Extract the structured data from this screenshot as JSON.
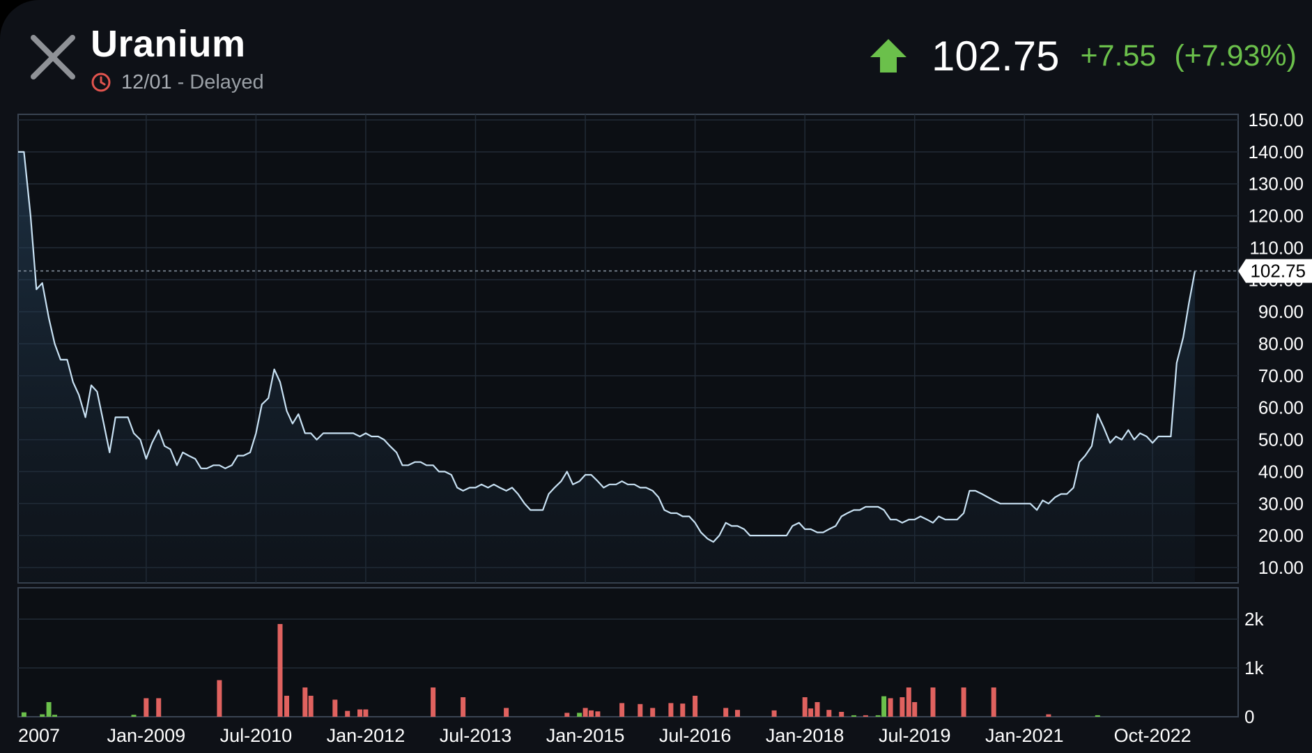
{
  "header": {
    "title": "Uranium",
    "date": "12/01",
    "separator": "-",
    "status": "Delayed",
    "price": "102.75",
    "change": "+7.55",
    "change_pct": "(+7.93%)"
  },
  "colors": {
    "up": "#6bc04b",
    "down": "#e0625f",
    "line": "#c9e2f4",
    "clock": "#e2544e"
  },
  "icons": {
    "close": "close-icon",
    "clock": "clock-icon",
    "trend": "arrow-up-icon"
  },
  "chart_data": {
    "type": "line",
    "price_axis": {
      "ylim": [
        0,
        150
      ],
      "ticks": [
        "150.00",
        "140.00",
        "130.00",
        "120.00",
        "110.00",
        "100.00",
        "90.00",
        "80.00",
        "70.00",
        "60.00",
        "50.00",
        "40.00",
        "30.00",
        "20.00",
        "10.00"
      ],
      "last_value_label": "102.75",
      "last_value": 102.75
    },
    "volume_axis": {
      "ylim": [
        0,
        2700
      ],
      "ticks": [
        {
          "label": "2k",
          "value": 2000
        },
        {
          "label": "1k",
          "value": 1000
        },
        {
          "label": "0",
          "value": 0
        }
      ]
    },
    "x_axis": {
      "range": [
        2007.25,
        2023.92
      ],
      "ticks": [
        {
          "label": "2007",
          "x": 2007.35
        },
        {
          "label": "Jan-2009",
          "x": 2009.0
        },
        {
          "label": "Jul-2010",
          "x": 2010.5
        },
        {
          "label": "Jan-2012",
          "x": 2012.0
        },
        {
          "label": "Jul-2013",
          "x": 2013.5
        },
        {
          "label": "Jan-2015",
          "x": 2015.0
        },
        {
          "label": "Jul-2016",
          "x": 2016.5
        },
        {
          "label": "Jan-2018",
          "x": 2018.0
        },
        {
          "label": "Jul-2019",
          "x": 2019.5
        },
        {
          "label": "Jan-2021",
          "x": 2021.0
        },
        {
          "label": "Oct-2022",
          "x": 2022.75
        }
      ]
    },
    "price_series": [
      [
        2007.25,
        140
      ],
      [
        2007.33,
        140
      ],
      [
        2007.42,
        120
      ],
      [
        2007.5,
        97
      ],
      [
        2007.58,
        99
      ],
      [
        2007.67,
        88
      ],
      [
        2007.75,
        80
      ],
      [
        2007.83,
        75
      ],
      [
        2007.92,
        75
      ],
      [
        2008.0,
        68
      ],
      [
        2008.08,
        64
      ],
      [
        2008.17,
        57
      ],
      [
        2008.25,
        67
      ],
      [
        2008.33,
        65
      ],
      [
        2008.42,
        55
      ],
      [
        2008.5,
        46
      ],
      [
        2008.58,
        57
      ],
      [
        2008.67,
        57
      ],
      [
        2008.75,
        57
      ],
      [
        2008.83,
        52
      ],
      [
        2008.92,
        50
      ],
      [
        2009.0,
        44
      ],
      [
        2009.08,
        49
      ],
      [
        2009.17,
        53
      ],
      [
        2009.25,
        48
      ],
      [
        2009.33,
        47
      ],
      [
        2009.42,
        42
      ],
      [
        2009.5,
        46
      ],
      [
        2009.58,
        45
      ],
      [
        2009.67,
        44
      ],
      [
        2009.75,
        41
      ],
      [
        2009.83,
        41
      ],
      [
        2009.92,
        42
      ],
      [
        2010.0,
        42
      ],
      [
        2010.08,
        41
      ],
      [
        2010.17,
        42
      ],
      [
        2010.25,
        45
      ],
      [
        2010.33,
        45
      ],
      [
        2010.42,
        46
      ],
      [
        2010.5,
        52
      ],
      [
        2010.58,
        61
      ],
      [
        2010.67,
        63
      ],
      [
        2010.75,
        72
      ],
      [
        2010.83,
        68
      ],
      [
        2010.92,
        59
      ],
      [
        2011.0,
        55
      ],
      [
        2011.08,
        58
      ],
      [
        2011.17,
        52
      ],
      [
        2011.25,
        52
      ],
      [
        2011.33,
        50
      ],
      [
        2011.42,
        52
      ],
      [
        2011.5,
        52
      ],
      [
        2011.58,
        52
      ],
      [
        2011.67,
        52
      ],
      [
        2011.75,
        52
      ],
      [
        2011.83,
        52
      ],
      [
        2011.92,
        51
      ],
      [
        2012.0,
        52
      ],
      [
        2012.08,
        51
      ],
      [
        2012.17,
        51
      ],
      [
        2012.25,
        50
      ],
      [
        2012.33,
        48
      ],
      [
        2012.42,
        46
      ],
      [
        2012.5,
        42
      ],
      [
        2012.58,
        42
      ],
      [
        2012.67,
        43
      ],
      [
        2012.75,
        43
      ],
      [
        2012.83,
        42
      ],
      [
        2012.92,
        42
      ],
      [
        2013.0,
        40
      ],
      [
        2013.08,
        40
      ],
      [
        2013.17,
        39
      ],
      [
        2013.25,
        35
      ],
      [
        2013.33,
        34
      ],
      [
        2013.42,
        35
      ],
      [
        2013.5,
        35
      ],
      [
        2013.58,
        36
      ],
      [
        2013.67,
        35
      ],
      [
        2013.75,
        36
      ],
      [
        2013.83,
        35
      ],
      [
        2013.92,
        34
      ],
      [
        2014.0,
        35
      ],
      [
        2014.08,
        33
      ],
      [
        2014.17,
        30
      ],
      [
        2014.25,
        28
      ],
      [
        2014.33,
        28
      ],
      [
        2014.42,
        28
      ],
      [
        2014.5,
        33
      ],
      [
        2014.58,
        35
      ],
      [
        2014.67,
        37
      ],
      [
        2014.75,
        40
      ],
      [
        2014.83,
        36
      ],
      [
        2014.92,
        37
      ],
      [
        2015.0,
        39
      ],
      [
        2015.08,
        39
      ],
      [
        2015.17,
        37
      ],
      [
        2015.25,
        35
      ],
      [
        2015.33,
        36
      ],
      [
        2015.42,
        36
      ],
      [
        2015.5,
        37
      ],
      [
        2015.58,
        36
      ],
      [
        2015.67,
        36
      ],
      [
        2015.75,
        35
      ],
      [
        2015.83,
        35
      ],
      [
        2015.92,
        34
      ],
      [
        2016.0,
        32
      ],
      [
        2016.08,
        28
      ],
      [
        2016.17,
        27
      ],
      [
        2016.25,
        27
      ],
      [
        2016.33,
        26
      ],
      [
        2016.42,
        26
      ],
      [
        2016.5,
        24
      ],
      [
        2016.58,
        21
      ],
      [
        2016.67,
        19
      ],
      [
        2016.75,
        18
      ],
      [
        2016.83,
        20
      ],
      [
        2016.92,
        24
      ],
      [
        2017.0,
        23
      ],
      [
        2017.08,
        23
      ],
      [
        2017.17,
        22
      ],
      [
        2017.25,
        20
      ],
      [
        2017.33,
        20
      ],
      [
        2017.42,
        20
      ],
      [
        2017.5,
        20
      ],
      [
        2017.58,
        20
      ],
      [
        2017.67,
        20
      ],
      [
        2017.75,
        20
      ],
      [
        2017.83,
        23
      ],
      [
        2017.92,
        24
      ],
      [
        2018.0,
        22
      ],
      [
        2018.08,
        22
      ],
      [
        2018.17,
        21
      ],
      [
        2018.25,
        21
      ],
      [
        2018.33,
        22
      ],
      [
        2018.42,
        23
      ],
      [
        2018.5,
        26
      ],
      [
        2018.58,
        27
      ],
      [
        2018.67,
        28
      ],
      [
        2018.75,
        28
      ],
      [
        2018.83,
        29
      ],
      [
        2018.92,
        29
      ],
      [
        2019.0,
        29
      ],
      [
        2019.08,
        28
      ],
      [
        2019.17,
        25
      ],
      [
        2019.25,
        25
      ],
      [
        2019.33,
        24
      ],
      [
        2019.42,
        25
      ],
      [
        2019.5,
        25
      ],
      [
        2019.58,
        26
      ],
      [
        2019.67,
        25
      ],
      [
        2019.75,
        24
      ],
      [
        2019.83,
        26
      ],
      [
        2019.92,
        25
      ],
      [
        2020.0,
        25
      ],
      [
        2020.08,
        25
      ],
      [
        2020.17,
        27
      ],
      [
        2020.25,
        34
      ],
      [
        2020.33,
        34
      ],
      [
        2020.42,
        33
      ],
      [
        2020.5,
        32
      ],
      [
        2020.58,
        31
      ],
      [
        2020.67,
        30
      ],
      [
        2020.75,
        30
      ],
      [
        2020.83,
        30
      ],
      [
        2020.92,
        30
      ],
      [
        2021.0,
        30
      ],
      [
        2021.08,
        30
      ],
      [
        2021.17,
        28
      ],
      [
        2021.25,
        31
      ],
      [
        2021.33,
        30
      ],
      [
        2021.42,
        32
      ],
      [
        2021.5,
        33
      ],
      [
        2021.58,
        33
      ],
      [
        2021.67,
        35
      ],
      [
        2021.75,
        43
      ],
      [
        2021.83,
        45
      ],
      [
        2021.92,
        48
      ],
      [
        2022.0,
        58
      ],
      [
        2022.08,
        54
      ],
      [
        2022.17,
        49
      ],
      [
        2022.25,
        51
      ],
      [
        2022.33,
        50
      ],
      [
        2022.42,
        53
      ],
      [
        2022.5,
        50
      ],
      [
        2022.58,
        52
      ],
      [
        2022.67,
        51
      ],
      [
        2022.75,
        49
      ],
      [
        2022.83,
        51
      ],
      [
        2022.92,
        51
      ],
      [
        2023.0,
        51
      ],
      [
        2023.08,
        74
      ],
      [
        2023.17,
        82
      ],
      [
        2023.25,
        93
      ],
      [
        2023.33,
        102.75
      ]
    ],
    "volume_series": [
      [
        2007.33,
        90,
        "up"
      ],
      [
        2007.58,
        50,
        "up"
      ],
      [
        2007.67,
        300,
        "up"
      ],
      [
        2007.75,
        40,
        "up"
      ],
      [
        2008.83,
        40,
        "up"
      ],
      [
        2009.0,
        380,
        "down"
      ],
      [
        2009.17,
        380,
        "down"
      ],
      [
        2010.0,
        750,
        "down"
      ],
      [
        2010.83,
        1900,
        "down"
      ],
      [
        2010.92,
        430,
        "down"
      ],
      [
        2011.17,
        600,
        "down"
      ],
      [
        2011.25,
        430,
        "down"
      ],
      [
        2011.58,
        350,
        "down"
      ],
      [
        2011.75,
        120,
        "down"
      ],
      [
        2011.92,
        150,
        "down"
      ],
      [
        2012.0,
        150,
        "down"
      ],
      [
        2012.92,
        600,
        "down"
      ],
      [
        2013.33,
        400,
        "down"
      ],
      [
        2013.92,
        180,
        "down"
      ],
      [
        2014.75,
        80,
        "down"
      ],
      [
        2014.92,
        80,
        "up"
      ],
      [
        2015.0,
        180,
        "down"
      ],
      [
        2015.08,
        130,
        "down"
      ],
      [
        2015.17,
        110,
        "down"
      ],
      [
        2015.5,
        280,
        "down"
      ],
      [
        2015.75,
        260,
        "down"
      ],
      [
        2015.92,
        180,
        "down"
      ],
      [
        2016.17,
        280,
        "down"
      ],
      [
        2016.33,
        270,
        "down"
      ],
      [
        2016.5,
        430,
        "down"
      ],
      [
        2016.92,
        180,
        "down"
      ],
      [
        2017.08,
        140,
        "down"
      ],
      [
        2017.58,
        130,
        "down"
      ],
      [
        2018.0,
        400,
        "down"
      ],
      [
        2018.08,
        170,
        "down"
      ],
      [
        2018.17,
        300,
        "down"
      ],
      [
        2018.33,
        140,
        "down"
      ],
      [
        2018.5,
        100,
        "down"
      ],
      [
        2018.67,
        30,
        "up"
      ],
      [
        2018.83,
        30,
        "down"
      ],
      [
        2019.0,
        30,
        "up"
      ],
      [
        2019.08,
        420,
        "up"
      ],
      [
        2019.17,
        380,
        "down"
      ],
      [
        2019.33,
        400,
        "down"
      ],
      [
        2019.42,
        600,
        "down"
      ],
      [
        2019.5,
        300,
        "down"
      ],
      [
        2019.75,
        600,
        "down"
      ],
      [
        2020.17,
        600,
        "down"
      ],
      [
        2020.58,
        600,
        "down"
      ],
      [
        2021.33,
        50,
        "down"
      ],
      [
        2022.0,
        30,
        "up"
      ]
    ]
  }
}
